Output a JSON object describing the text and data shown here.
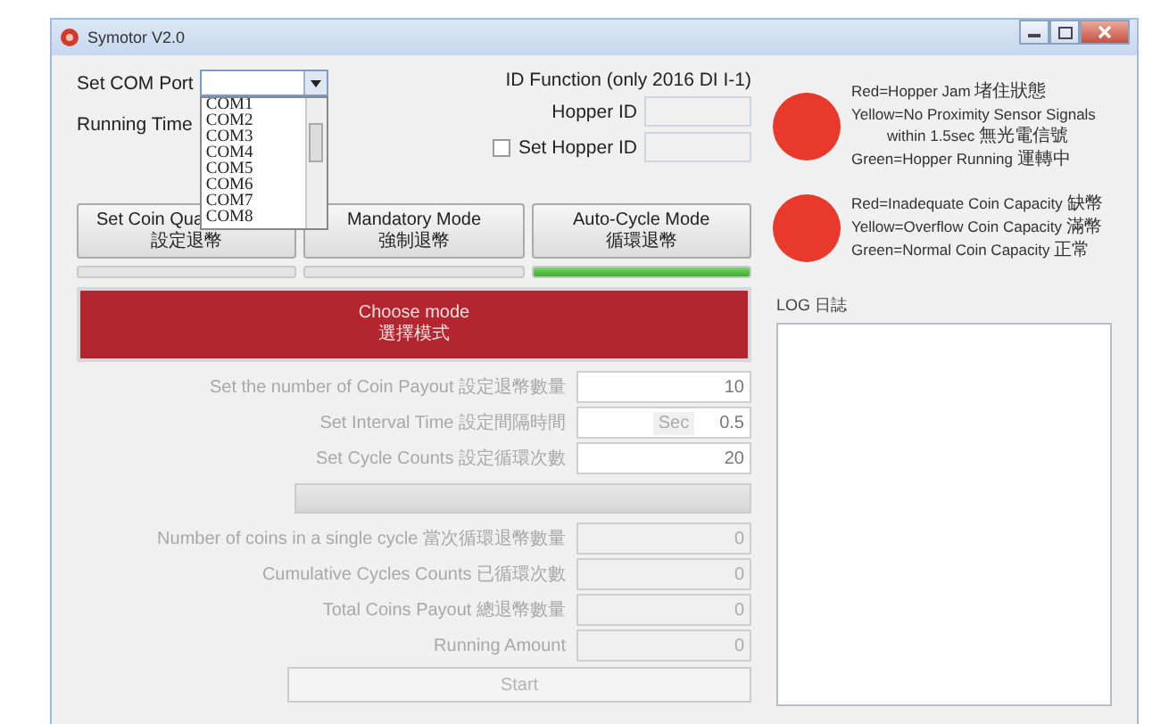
{
  "window": {
    "title": "Symotor V2.0"
  },
  "com_port": {
    "label": "Set COM Port",
    "expanded": true,
    "options": [
      "COM1",
      "COM2",
      "COM3",
      "COM4",
      "COM5",
      "COM6",
      "COM7",
      "COM8"
    ]
  },
  "running_time": {
    "label": "Running Time"
  },
  "id_function": {
    "title": "ID Function (only 2016 DI I-1)",
    "hopper_id_label": "Hopper ID",
    "set_hopper_id": {
      "label": "Set Hopper ID",
      "checked": false
    }
  },
  "modes": [
    {
      "label": "Set Coin Qua",
      "label_zh": "設定退幣",
      "level": 0
    },
    {
      "label": "Mandatory Mode",
      "label_zh": "強制退幣",
      "level": 0
    },
    {
      "label": "Auto-Cycle Mode",
      "label_zh": "循環退幣",
      "level": 1
    }
  ],
  "banner": {
    "label": "Choose mode",
    "label_zh": "選擇模式"
  },
  "settings": [
    {
      "label": "Set the number of Coin Payout 設定退幣數量",
      "value": "10"
    },
    {
      "label": "Set Interval Time 設定間隔時間",
      "unit": "Sec",
      "value": "0.5"
    },
    {
      "label": "Set Cycle Counts 設定循環次數",
      "value": "20"
    }
  ],
  "progress": {
    "level": 0
  },
  "stats": [
    {
      "label": "Number of coins in a single cycle 當次循環退幣數量",
      "value": "0"
    },
    {
      "label": "Cumulative Cycles Counts 已循環次數",
      "value": "0"
    },
    {
      "label": "Total Coins Payout 總退幣數量",
      "value": "0"
    },
    {
      "label": "Running Amount",
      "value": "0"
    }
  ],
  "start_button": {
    "label": "Start",
    "disabled": true
  },
  "indicators": [
    {
      "color": "#e8392c",
      "legend": [
        "Red=Hopper Jam 堵住狀態",
        "Yellow=No Proximity Sensor Signals",
        "within 1.5sec 無光電信號",
        "Green=Hopper Running 運轉中"
      ]
    },
    {
      "color": "#e8392c",
      "legend": [
        "Red=Inadequate Coin Capacity 缺幣",
        "Yellow=Overflow Coin Capacity 滿幣",
        "Green=Normal Coin Capacity 正常"
      ]
    }
  ],
  "log": {
    "label": "LOG 日誌"
  }
}
